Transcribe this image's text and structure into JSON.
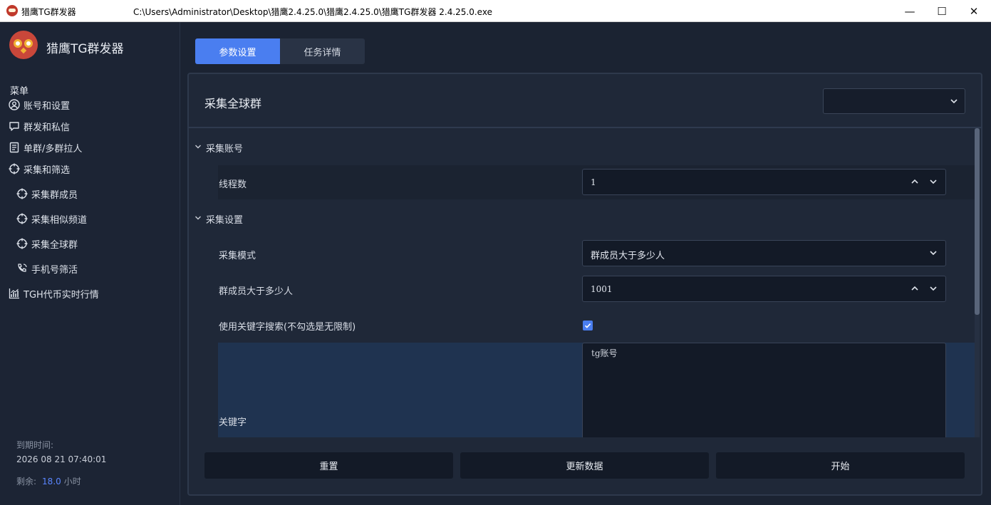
{
  "window": {
    "app_name": "猎鹰TG群发器",
    "path": "C:\\Users\\Administrator\\Desktop\\猎鹰2.4.25.0\\猎鹰2.4.25.0\\猎鹰TG群发器 2.4.25.0.exe",
    "minimize": "—",
    "maximize": "☐",
    "close": "✕"
  },
  "sidebar": {
    "brand": "猎鹰TG群发器",
    "menu_title": "菜单",
    "items": [
      {
        "label": "账号和设置",
        "icon": "user-circle-icon"
      },
      {
        "label": "群发和私信",
        "icon": "chat-bubble-icon"
      },
      {
        "label": "单群/多群拉人",
        "icon": "document-icon"
      },
      {
        "label": "采集和筛选",
        "icon": "crosshair-icon"
      },
      {
        "label": "采集群成员",
        "icon": "crosshair-icon"
      },
      {
        "label": "采集相似频道",
        "icon": "crosshair-icon"
      },
      {
        "label": "采集全球群",
        "icon": "crosshair-icon"
      },
      {
        "label": "手机号筛活",
        "icon": "phone-icon"
      },
      {
        "label": "TGH代币实时行情",
        "icon": "chart-icon"
      }
    ],
    "expire_label": "到期时间:",
    "expire_time": "2026 08 21 07:40:01",
    "remain_label": "剩余:",
    "remain_value": "18.0",
    "remain_unit": "小时"
  },
  "tabs": {
    "params": "参数设置",
    "details": "任务详情"
  },
  "panel": {
    "title": "采集全球群",
    "top_select_value": "",
    "section_account": "采集账号",
    "threads_label": "线程数",
    "threads_value": "1",
    "section_settings": "采集设置",
    "mode_label": "采集模式",
    "mode_value": "群成员大于多少人",
    "min_members_label": "群成员大于多少人",
    "min_members_value": "1001",
    "use_keyword_label": "使用关键字搜索(不勾选是无限制)",
    "use_keyword_checked": true,
    "keyword_label": "关键字",
    "keyword_placeholder": "tg账号"
  },
  "buttons": {
    "reset": "重置",
    "update": "更新数据",
    "start": "开始"
  },
  "colors": {
    "accent": "#4a7ef0",
    "background": "#1b2332",
    "panel": "#1f2838"
  }
}
